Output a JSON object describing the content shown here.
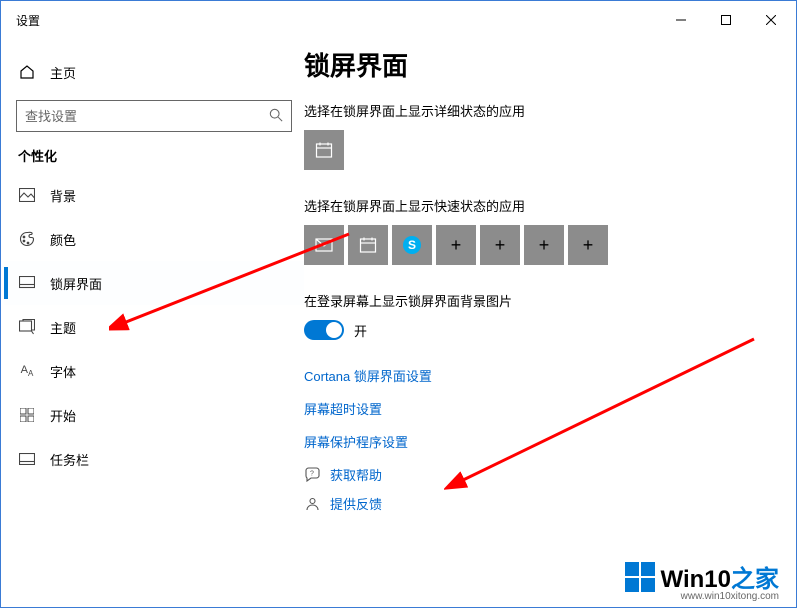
{
  "window": {
    "title": "设置"
  },
  "sidebar": {
    "home": "主页",
    "search_placeholder": "查找设置",
    "section": "个性化",
    "items": [
      {
        "label": "背景"
      },
      {
        "label": "颜色"
      },
      {
        "label": "锁屏界面"
      },
      {
        "label": "主题"
      },
      {
        "label": "字体"
      },
      {
        "label": "开始"
      },
      {
        "label": "任务栏"
      }
    ]
  },
  "main": {
    "heading": "锁屏界面",
    "detail_status_label": "选择在锁屏界面上显示详细状态的应用",
    "quick_status_label": "选择在锁屏界面上显示快速状态的应用",
    "show_bg_label": "在登录屏幕上显示锁屏界面背景图片",
    "toggle_state": "开",
    "links": {
      "cortana": "Cortana 锁屏界面设置",
      "timeout": "屏幕超时设置",
      "screensaver": "屏幕保护程序设置"
    },
    "footer": {
      "help": "获取帮助",
      "feedback": "提供反馈"
    }
  },
  "watermark": {
    "text1": "Win10",
    "text2": "之家",
    "url": "www.win10xitong.com"
  }
}
